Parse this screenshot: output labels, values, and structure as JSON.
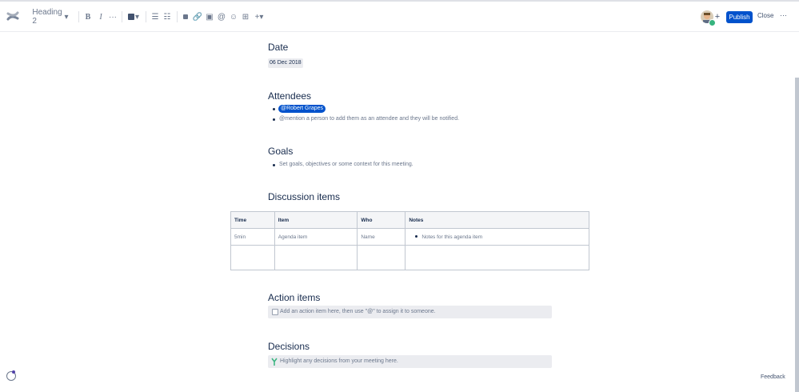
{
  "toolbar": {
    "heading_style": "Heading 2",
    "publish_label": "Publish",
    "close_label": "Close",
    "text_color": "#172b4d",
    "accent": "#0052cc"
  },
  "page": {
    "date_heading": "Date",
    "date_value": "06 Dec 2018",
    "attendees_heading": "Attendees",
    "attendee_mention": "@Robert Grapes",
    "attendee_placeholder": "@mention a person to add them as an attendee and they will be notified.",
    "goals_heading": "Goals",
    "goals_placeholder": "Set goals, objectives or some context for this meeting.",
    "discussion_heading": "Discussion items",
    "table": {
      "headers": [
        "Time",
        "Item",
        "Who",
        "Notes"
      ],
      "row": [
        "5min",
        "Agenda item",
        "Name",
        "Notes for this agenda item"
      ]
    },
    "action_heading": "Action items",
    "action_placeholder": "Add an action item here, then use \"@\" to assign it to someone.",
    "decisions_heading": "Decisions",
    "decisions_placeholder": "Highlight any decisions from your meeting here."
  },
  "footer": {
    "feedback_label": "Feedback"
  }
}
